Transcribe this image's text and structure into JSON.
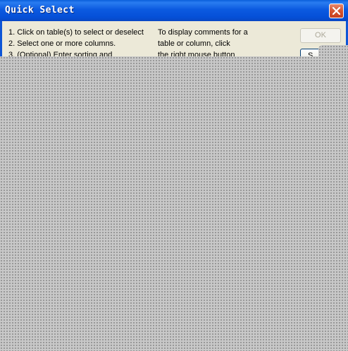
{
  "window": {
    "title": "Quick Select"
  },
  "instructions": {
    "left": [
      "1. Click on table(s) to select or deselect",
      "2. Select one or more columns.",
      "3. (Optional) Enter sorting and"
    ],
    "right": [
      "To display comments for a",
      "table or column, click",
      "the right mouse button"
    ]
  },
  "buttons": {
    "ok_label": "OK",
    "second_label_partial": "S"
  }
}
